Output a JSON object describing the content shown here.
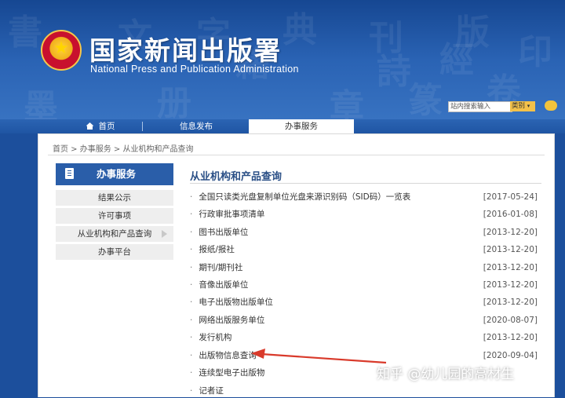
{
  "header": {
    "title_cn": "国家新闻出版署",
    "title_en": "National  Press and Publication Administration",
    "search_placeholder": "站内搜索输入",
    "search_category": "类别",
    "background_glyphs": [
      "書",
      "文",
      "字",
      "典",
      "刊",
      "版",
      "印",
      "墨",
      "册",
      "章",
      "篆",
      "卷",
      "籍",
      "詩",
      "經"
    ]
  },
  "nav": {
    "items": [
      {
        "label": "首页",
        "icon": "home-icon"
      },
      {
        "label": "信息发布"
      },
      {
        "label": "办事服务",
        "active": true
      }
    ]
  },
  "breadcrumb": "首页 > 办事服务 > 从业机构和产品查询",
  "sidebar": {
    "title": "办事服务",
    "items": [
      {
        "label": "结果公示"
      },
      {
        "label": "许可事项"
      },
      {
        "label": "从业机构和产品查询",
        "active": true
      },
      {
        "label": "办事平台"
      }
    ]
  },
  "main": {
    "title": "从业机构和产品查询",
    "list": [
      {
        "text": "全国只读类光盘复制单位光盘来源识别码（SID码）一览表",
        "date": "[2017-05-24]"
      },
      {
        "text": "行政审批事项清单",
        "date": "[2016-01-08]"
      },
      {
        "text": "图书出版单位",
        "date": "[2013-12-20]"
      },
      {
        "text": "报纸/报社",
        "date": "[2013-12-20]"
      },
      {
        "text": "期刊/期刊社",
        "date": "[2013-12-20]"
      },
      {
        "text": "音像出版单位",
        "date": "[2013-12-20]"
      },
      {
        "text": "电子出版物出版单位",
        "date": "[2013-12-20]"
      },
      {
        "text": "网络出版服务单位",
        "date": "[2020-08-07]"
      },
      {
        "text": "发行机构",
        "date": "[2013-12-20]"
      },
      {
        "text": "出版物信息查询",
        "date": "[2020-09-04]"
      },
      {
        "text": "连续型电子出版物",
        "date": ""
      },
      {
        "text": "记者证",
        "date": ""
      }
    ]
  },
  "watermark": "知乎 @幼儿园的高材生",
  "colors": {
    "header_blue": "#1c4f9c",
    "nav_blue": "#2a5ea9",
    "annotation_red": "#d93a2b",
    "search_yellow": "#f3c14a"
  }
}
